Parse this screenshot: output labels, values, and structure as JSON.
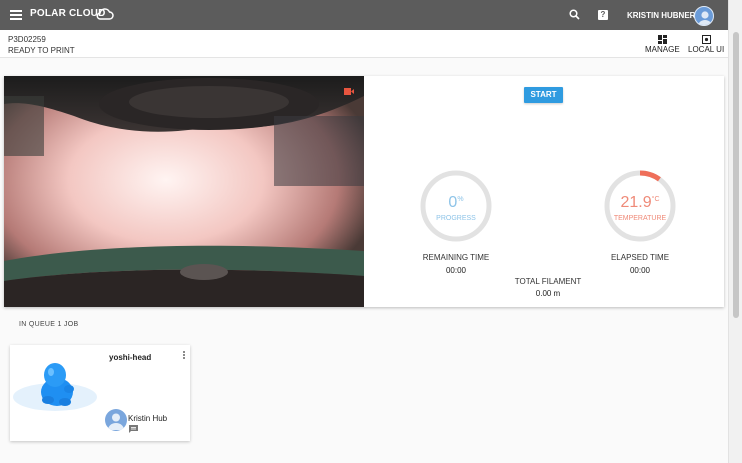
{
  "topbar": {
    "brand": "POLAR CLOUD",
    "user_name": "KRISTIN HUBNER",
    "icons": [
      "menu-icon",
      "cloud-icon",
      "search-icon",
      "help-icon",
      "avatar"
    ]
  },
  "printer": {
    "id": "P3D02259",
    "status": "READY TO PRINT",
    "actions": {
      "manage": "MANAGE",
      "local_ui": "LOCAL UI"
    }
  },
  "controls": {
    "start_label": "START"
  },
  "gauges": {
    "progress": {
      "value": "0",
      "unit": "%",
      "label": "PROGRESS",
      "fraction": 0
    },
    "temperature": {
      "value": "21.9",
      "unit": "°C",
      "label": "TEMPERATURE",
      "fraction": 0.1
    }
  },
  "stats": {
    "remaining_label": "REMAINING TIME",
    "remaining_value": "00:00",
    "elapsed_label": "ELAPSED TIME",
    "elapsed_value": "00:00",
    "filament_label": "TOTAL FILAMENT",
    "filament_value": "0.00 m"
  },
  "queue": {
    "title": "IN QUEUE 1 JOB",
    "jobs": [
      {
        "name": "yoshi-head",
        "owner": "Kristin Hub"
      }
    ]
  },
  "colors": {
    "topbar": "#5c5c5c",
    "accent_blue": "#2f9be0",
    "progress": "#8ec4e8",
    "temperature": "#ef6f5a"
  }
}
